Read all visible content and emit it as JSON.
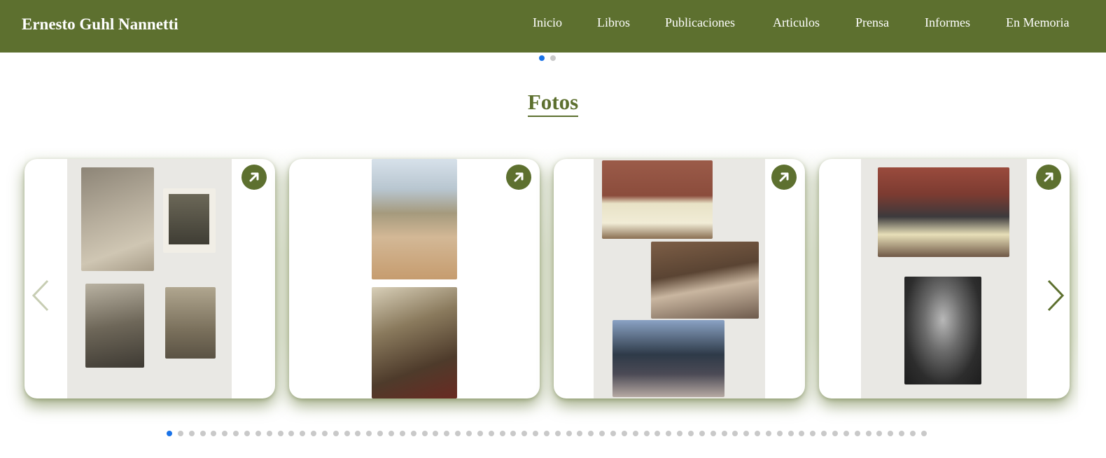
{
  "site": {
    "brand": "Ernesto Guhl Nannetti"
  },
  "nav": {
    "items": [
      {
        "label": "Inicio"
      },
      {
        "label": "Libros"
      },
      {
        "label": "Publicaciones"
      },
      {
        "label": "Articulos"
      },
      {
        "label": "Prensa"
      },
      {
        "label": "Informes"
      },
      {
        "label": "En Memoria"
      }
    ]
  },
  "top_pagination": {
    "total": 2,
    "active": 1
  },
  "gallery": {
    "title": "Fotos",
    "card_count_visible": 4,
    "cards": [
      {
        "description": ""
      },
      {
        "description": ""
      },
      {
        "description": ""
      },
      {
        "description": ""
      }
    ],
    "open_icon": "arrow-up-right-icon",
    "prev_icon": "chevron-left-icon",
    "next_icon": "chevron-right-icon"
  },
  "bottom_pagination": {
    "total": 69,
    "active": 1
  },
  "colors": {
    "brand_green": "#5d702f",
    "active_dot": "#1a73e8",
    "inactive_dot": "#c9c9c9"
  }
}
